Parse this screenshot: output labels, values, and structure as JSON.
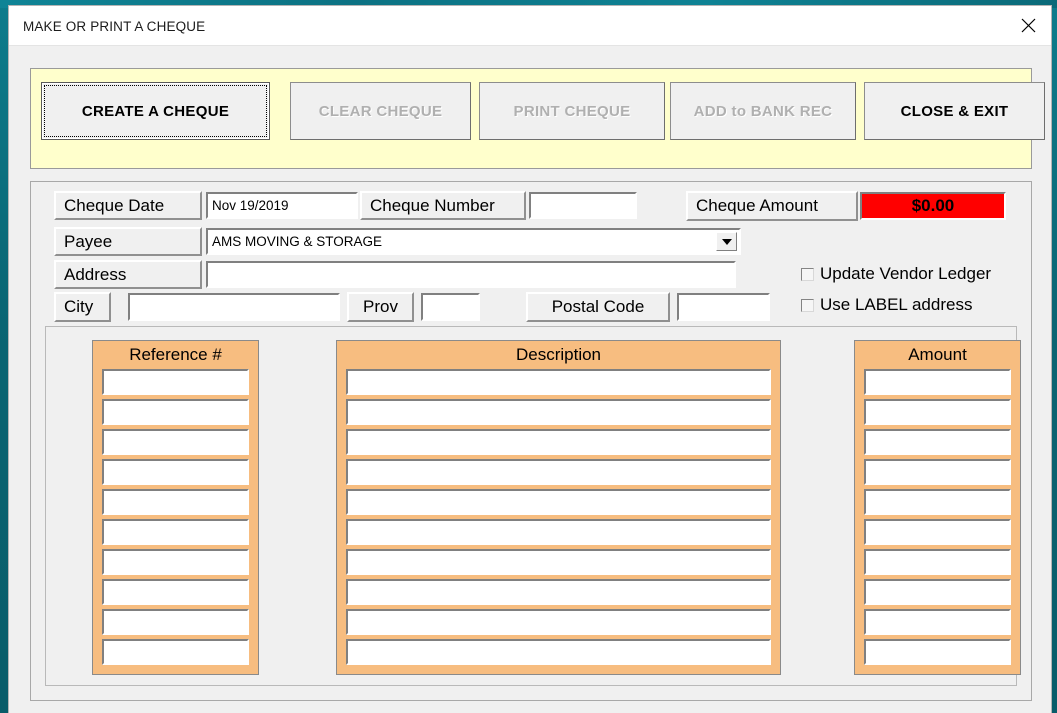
{
  "window": {
    "title": "MAKE OR PRINT A CHEQUE",
    "close_icon": "close-icon"
  },
  "toolbar": {
    "buttons": [
      {
        "id": "create",
        "label": "CREATE A CHEQUE",
        "enabled": true,
        "focused": true
      },
      {
        "id": "clear",
        "label": "CLEAR CHEQUE",
        "enabled": false,
        "focused": false
      },
      {
        "id": "print",
        "label": "PRINT CHEQUE",
        "enabled": false,
        "focused": false
      },
      {
        "id": "bank",
        "label": "ADD to BANK REC",
        "enabled": false,
        "focused": false
      },
      {
        "id": "close",
        "label": "CLOSE & EXIT",
        "enabled": true,
        "focused": false
      }
    ],
    "background_color": "#ffffcc"
  },
  "form": {
    "cheque_date": {
      "label": "Cheque Date",
      "value": "Nov 19/2019",
      "placeholder": ""
    },
    "cheque_number": {
      "label": "Cheque Number",
      "value": "",
      "placeholder": ""
    },
    "cheque_amount": {
      "label": "Cheque Amount",
      "value": "$0.00",
      "background_color": "#ff0000"
    },
    "payee": {
      "label": "Payee",
      "value": "AMS MOVING & STORAGE",
      "dropdown_icon": "chevron-down-icon"
    },
    "address": {
      "label": "Address",
      "value": "",
      "placeholder": ""
    },
    "city": {
      "label": "City",
      "value": "",
      "placeholder": ""
    },
    "prov": {
      "label": "Prov",
      "value": "",
      "placeholder": ""
    },
    "postal_code": {
      "label": "Postal Code",
      "value": "",
      "placeholder": ""
    },
    "checkboxes": [
      {
        "id": "update-vendor-ledger",
        "label": "Update Vendor Ledger",
        "checked": false
      },
      {
        "id": "use-label-address",
        "label": "Use LABEL address",
        "checked": false
      }
    ]
  },
  "grid": {
    "header_color": "#f7bd80",
    "row_count": 10,
    "columns": [
      {
        "id": "reference",
        "header": "Reference #",
        "values": [
          "",
          "",
          "",
          "",
          "",
          "",
          "",
          "",
          "",
          ""
        ]
      },
      {
        "id": "description",
        "header": "Description",
        "values": [
          "",
          "",
          "",
          "",
          "",
          "",
          "",
          "",
          "",
          ""
        ]
      },
      {
        "id": "amount",
        "header": "Amount",
        "values": [
          "",
          "",
          "",
          "",
          "",
          "",
          "",
          "",
          "",
          ""
        ]
      }
    ]
  }
}
